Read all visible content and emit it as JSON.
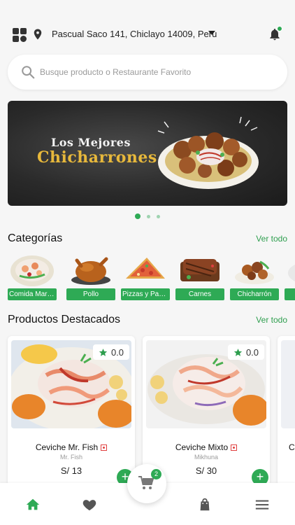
{
  "header": {
    "address": "Pascual Saco 141, Chiclayo 14009, Peru",
    "icons": [
      "grid-icon",
      "location-pin-icon",
      "dropdown-caret-icon",
      "bell-icon"
    ]
  },
  "search": {
    "placeholder": "Busque producto o Restaurante Favorito"
  },
  "banner": {
    "line1": "Los Mejores",
    "line2": "Chicharrones",
    "slides": 3,
    "active_slide": 1
  },
  "categories": {
    "title": "Categorías",
    "link": "Ver todo",
    "items": [
      {
        "label": "Comida Marina"
      },
      {
        "label": "Pollo"
      },
      {
        "label": "Pizzas y Pastas"
      },
      {
        "label": "Carnes"
      },
      {
        "label": "Chicharrón"
      }
    ]
  },
  "products": {
    "title": "Productos Destacados",
    "link": "Ver todo",
    "items": [
      {
        "name": "Ceviche Mr. Fish",
        "restaurant": "Mr. Fish",
        "price": "S/ 13",
        "rating": "0.0"
      },
      {
        "name": "Ceviche Mixto",
        "restaurant": "Mikhuna",
        "price": "S/ 30",
        "rating": "0.0"
      }
    ],
    "peek_letter": "C"
  },
  "cart": {
    "count": "2"
  },
  "nav": {
    "items": [
      "home-icon",
      "heart-icon",
      "cart-icon",
      "shopping-bag-icon",
      "menu-icon"
    ]
  },
  "colors": {
    "accent": "#2eaa55",
    "link": "#2e9e4e"
  }
}
